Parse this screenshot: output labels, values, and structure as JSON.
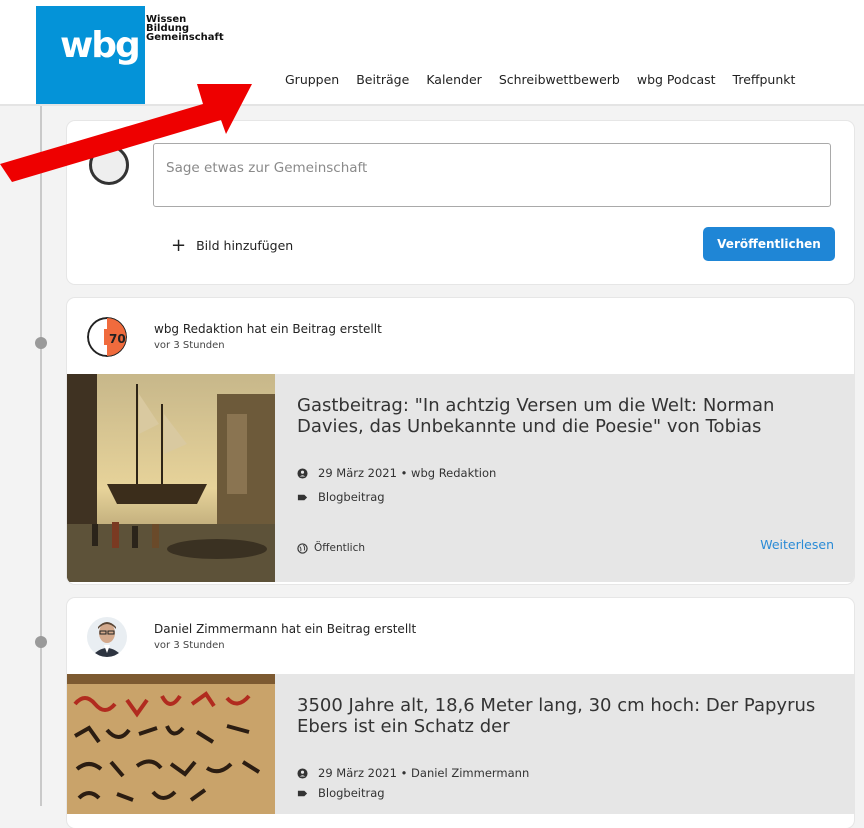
{
  "logo": {
    "word": "wbg",
    "tag_lines": [
      "Wissen",
      "Bildung",
      "Gemeinschaft"
    ]
  },
  "nav": [
    "Gruppen",
    "Beiträge",
    "Kalender",
    "Schreibwettbewerb",
    "wbg Podcast",
    "Treffpunkt"
  ],
  "composer": {
    "placeholder": "Sage etwas zur Gemeinschaft",
    "add_image": "Bild hinzufügen",
    "publish": "Veröffentlichen"
  },
  "posts": [
    {
      "author_line": "wbg Redaktion hat ein Beitrag erstellt",
      "time": "vor 3 Stunden",
      "title": "Gastbeitrag: \"In achtzig Versen um die Welt: Norman Davies, das Unbekannte und die Poesie\" von Tobias",
      "date_author": "29 März 2021 • wbg Redaktion",
      "category": "Blogbeitrag",
      "visibility": "Öffentlich",
      "read_more": "Weiterlesen"
    },
    {
      "author_line": "Daniel Zimmermann hat ein Beitrag erstellt",
      "time": "vor 3 Stunden",
      "title": "3500 Jahre alt, 18,6 Meter lang, 30 cm hoch: Der Papyrus Ebers ist ein Schatz der",
      "date_author": "29 März 2021 • Daniel Zimmermann",
      "category": "Blogbeitrag"
    }
  ],
  "colors": {
    "brand_blue": "#0493d8",
    "button_blue": "#1f86d6",
    "link_blue": "#2a8bd6",
    "annotation_red": "#ee0000"
  }
}
